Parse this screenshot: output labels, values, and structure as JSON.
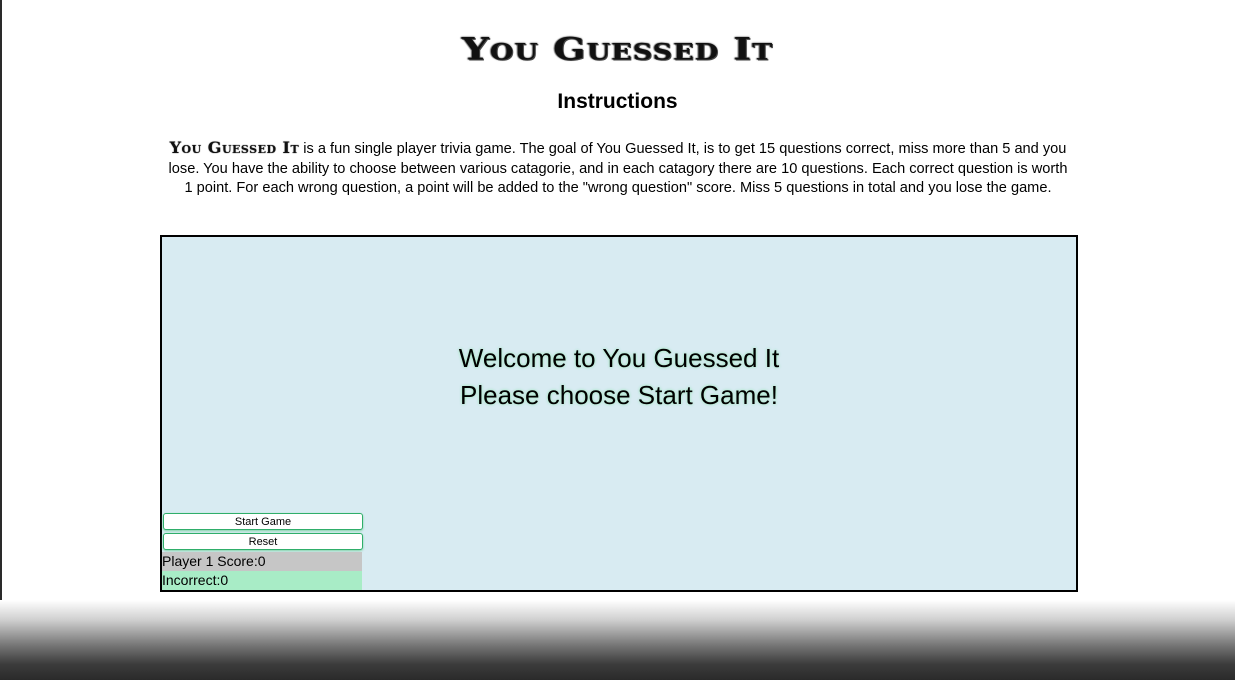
{
  "logo": {
    "text": "You Guessed It"
  },
  "instructions": {
    "title": "Instructions",
    "inline_logo": "You Guessed It",
    "body": " is a fun single player trivia game. The goal of You Guessed It, is to get 15 questions correct, miss more than 5 and you lose. You have the ability to choose between various catagorie, and in each catagory there are 10 questions. Each correct question is worth 1 point. For each wrong question, a point will be added to the \"wrong question\" score. Miss 5 questions in total and you lose the game."
  },
  "game": {
    "welcome_line1": "Welcome to You Guessed It",
    "welcome_line2": "Please choose Start Game!",
    "start_label": "Start Game",
    "reset_label": "Reset",
    "score_label": "Player 1 Score:",
    "score_value": "0",
    "incorrect_label": "Incorrect:",
    "incorrect_value": "0"
  },
  "colors": {
    "game_bg": "#d8ebf2",
    "score_bg": "#c6c6c6",
    "incorrect_bg": "#a8ecc6",
    "button_border": "#2fae6a"
  }
}
